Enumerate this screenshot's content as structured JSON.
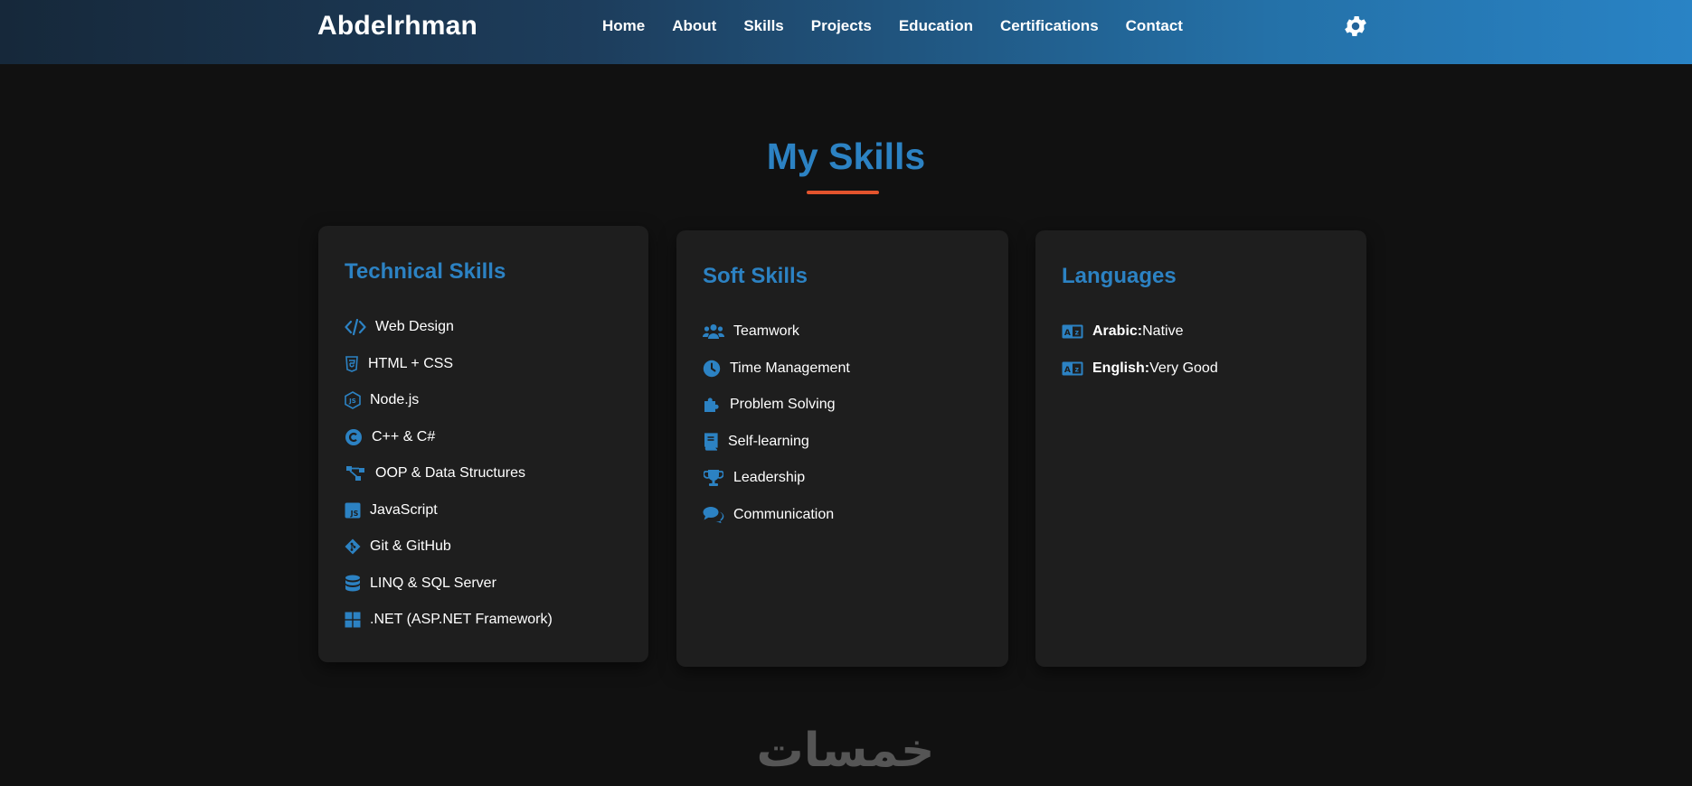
{
  "header": {
    "brand": "Abdelrhman",
    "nav": [
      "Home",
      "About",
      "Skills",
      "Projects",
      "Education",
      "Certifications",
      "Contact"
    ],
    "theme_toggle_icon": "gear-icon"
  },
  "section": {
    "title": "My Skills",
    "accent_color": "#2c82c3",
    "underline_color": "#e3542d"
  },
  "technical": {
    "title": "Technical Skills",
    "items": [
      {
        "label": "Web Design",
        "icon": "code-icon"
      },
      {
        "label": "HTML + CSS",
        "icon": "css3-icon"
      },
      {
        "label": "Node.js",
        "icon": "nodejs-icon"
      },
      {
        "label": "C++ & C#",
        "icon": "copyright-icon"
      },
      {
        "label": "OOP & Data Structures",
        "icon": "sitemap-icon"
      },
      {
        "label": "JavaScript",
        "icon": "js-square-icon"
      },
      {
        "label": "Git & GitHub",
        "icon": "git-icon"
      },
      {
        "label": "LINQ & SQL Server",
        "icon": "database-icon"
      },
      {
        "label": ".NET (ASP.NET Framework)",
        "icon": "windows-icon"
      }
    ]
  },
  "soft": {
    "title": "Soft Skills",
    "items": [
      {
        "label": "Teamwork",
        "icon": "users-icon"
      },
      {
        "label": "Time Management",
        "icon": "clock-icon"
      },
      {
        "label": "Problem Solving",
        "icon": "puzzle-icon"
      },
      {
        "label": "Self-learning",
        "icon": "book-icon"
      },
      {
        "label": "Leadership",
        "icon": "trophy-icon"
      },
      {
        "label": "Communication",
        "icon": "comments-icon"
      }
    ]
  },
  "languages": {
    "title": "Languages",
    "items": [
      {
        "name": "Arabic:",
        "level": "Native",
        "icon": "language-icon"
      },
      {
        "name": "English:",
        "level": "Very Good",
        "icon": "language-icon"
      }
    ]
  },
  "footer": {
    "watermark_icon": "khamsat-logo-icon",
    "watermark_text": "خمسات"
  }
}
